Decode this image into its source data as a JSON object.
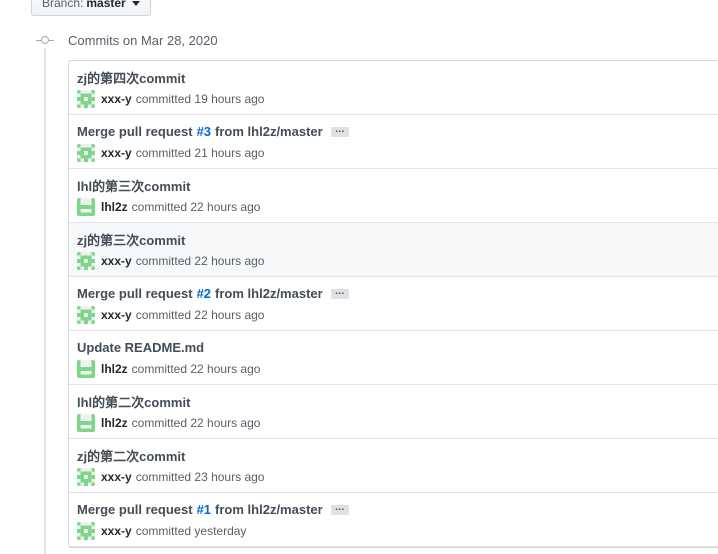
{
  "branch": {
    "prefix": "Branch:",
    "name": "master"
  },
  "group": {
    "title": "Commits on Mar 28, 2020"
  },
  "commits": [
    {
      "title": "zj的第四次commit",
      "author": "xxx-y",
      "action": "committed",
      "time": "19 hours ago",
      "avatar": "identicon-green-pattern"
    },
    {
      "title_prefix": "Merge pull request",
      "pr": "#3",
      "title_suffix": "from lhl2z/master",
      "ellipsis": "…",
      "author": "xxx-y",
      "action": "committed",
      "time": "21 hours ago",
      "avatar": "identicon-green-pattern"
    },
    {
      "title": "lhl的第三次commit",
      "author": "lhl2z",
      "action": "committed",
      "time": "22 hours ago",
      "avatar": "identicon-green-h"
    },
    {
      "title": "zj的第三次commit",
      "author": "xxx-y",
      "action": "committed",
      "time": "22 hours ago",
      "avatar": "identicon-green-pattern"
    },
    {
      "title_prefix": "Merge pull request",
      "pr": "#2",
      "title_suffix": "from lhl2z/master",
      "ellipsis": "…",
      "author": "xxx-y",
      "action": "committed",
      "time": "22 hours ago",
      "avatar": "identicon-green-pattern"
    },
    {
      "title": "Update README.md",
      "author": "lhl2z",
      "action": "committed",
      "time": "22 hours ago",
      "avatar": "identicon-green-h"
    },
    {
      "title": "lhl的第二次commit",
      "author": "lhl2z",
      "action": "committed",
      "time": "22 hours ago",
      "avatar": "identicon-green-h"
    },
    {
      "title": "zj的第二次commit",
      "author": "xxx-y",
      "action": "committed",
      "time": "23 hours ago",
      "avatar": "identicon-green-pattern"
    },
    {
      "title_prefix": "Merge pull request",
      "pr": "#1",
      "title_suffix": "from lhl2z/master",
      "ellipsis": "…",
      "author": "xxx-y",
      "action": "committed",
      "time": "yesterday",
      "avatar": "identicon-green-pattern"
    }
  ],
  "colors": {
    "link": "#0366d6",
    "avatar_green": "#7ed68a",
    "alt_row": "#f6f8fa"
  }
}
